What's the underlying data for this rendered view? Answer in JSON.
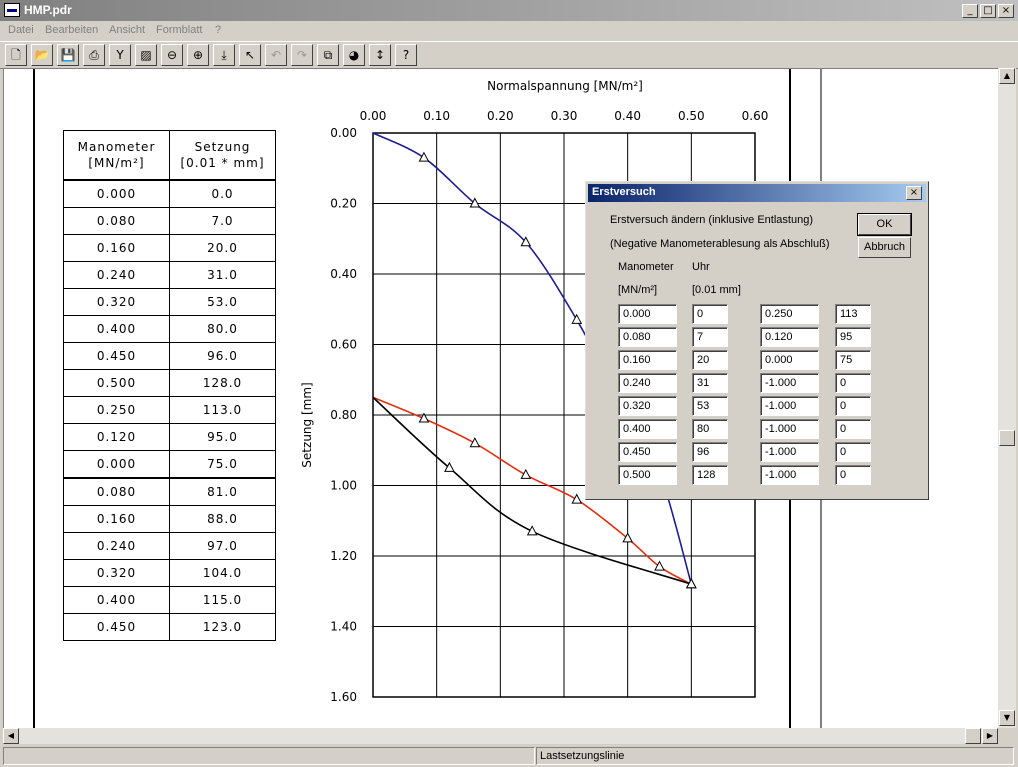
{
  "window": {
    "title": "HMP.pdr"
  },
  "menu": [
    "Datei",
    "Bearbeiten",
    "Ansicht",
    "Formblatt",
    "?"
  ],
  "toolbar_icons": [
    "new-file-icon",
    "open-folder-icon",
    "save-icon",
    "print-icon",
    "tools-icon",
    "print-preview-icon",
    "zoom-out-icon",
    "zoom-in-icon",
    "download-icon",
    "pointer-icon",
    "undo-icon",
    "redo-icon",
    "copy-icon",
    "camera-icon",
    "vertical-arrows-icon",
    "help-icon"
  ],
  "table": {
    "headers": [
      "Manometer\n[MN/m²]",
      "Setzung\n[0.01 * mm]"
    ],
    "rows": [
      [
        "0.000",
        "0.0"
      ],
      [
        "0.080",
        "7.0"
      ],
      [
        "0.160",
        "20.0"
      ],
      [
        "0.240",
        "31.0"
      ],
      [
        "0.320",
        "53.0"
      ],
      [
        "0.400",
        "80.0"
      ],
      [
        "0.450",
        "96.0"
      ],
      [
        "0.500",
        "128.0"
      ],
      [
        "0.250",
        "113.0"
      ],
      [
        "0.120",
        "95.0"
      ],
      [
        "0.000",
        "75.0"
      ],
      [
        "0.080",
        "81.0"
      ],
      [
        "0.160",
        "88.0"
      ],
      [
        "0.240",
        "97.0"
      ],
      [
        "0.320",
        "104.0"
      ],
      [
        "0.400",
        "115.0"
      ],
      [
        "0.450",
        "123.0"
      ]
    ]
  },
  "chart_data": {
    "type": "line",
    "title": "Normalspannung [MN/m²]",
    "xlabel": "Normalspannung [MN/m²]",
    "ylabel": "Setzung [mm]",
    "x_ticks": [
      "0.00",
      "0.10",
      "0.20",
      "0.30",
      "0.40",
      "0.50",
      "0.60"
    ],
    "y_ticks": [
      "0.00",
      "0.20",
      "0.40",
      "0.60",
      "0.80",
      "1.00",
      "1.20",
      "1.40",
      "1.60"
    ],
    "xlim": [
      0,
      0.6
    ],
    "ylim": [
      0,
      1.6
    ],
    "y_inverted": true,
    "x_axis_position": "top",
    "grid": true,
    "series": [
      {
        "color": "#1f1f8f",
        "markers": true,
        "points": [
          [
            0,
            0
          ],
          [
            0.08,
            0.07
          ],
          [
            0.16,
            0.2
          ],
          [
            0.24,
            0.31
          ],
          [
            0.32,
            0.53
          ],
          [
            0.4,
            0.8
          ],
          [
            0.45,
            0.96
          ],
          [
            0.5,
            1.28
          ]
        ]
      },
      {
        "color": "#e03010",
        "markers": true,
        "points": [
          [
            0,
            0.75
          ],
          [
            0.08,
            0.81
          ],
          [
            0.16,
            0.88
          ],
          [
            0.24,
            0.97
          ],
          [
            0.32,
            1.04
          ],
          [
            0.4,
            1.15
          ],
          [
            0.45,
            1.23
          ],
          [
            0.5,
            1.28
          ]
        ]
      },
      {
        "color": "#000000",
        "markers": true,
        "points": [
          [
            0,
            0.75
          ],
          [
            0.12,
            0.95
          ],
          [
            0.25,
            1.13
          ],
          [
            0.5,
            1.28
          ]
        ]
      }
    ]
  },
  "dialog": {
    "title": "Erstversuch",
    "line1": "Erstversuch ändern (inklusive Entlastung)",
    "line2": "(Negative Manometerablesung als Abschluß)",
    "col1_header": "Manometer",
    "col1_unit": "[MN/m²]",
    "col2_header": "Uhr",
    "col2_unit": "[0.01 mm]",
    "ok_label": "OK",
    "cancel_label": "Abbruch",
    "left_rows": [
      [
        "0.000",
        "0"
      ],
      [
        "0.080",
        "7"
      ],
      [
        "0.160",
        "20"
      ],
      [
        "0.240",
        "31"
      ],
      [
        "0.320",
        "53"
      ],
      [
        "0.400",
        "80"
      ],
      [
        "0.450",
        "96"
      ],
      [
        "0.500",
        "128"
      ]
    ],
    "right_rows": [
      [
        "0.250",
        "113"
      ],
      [
        "0.120",
        "95"
      ],
      [
        "0.000",
        "75"
      ],
      [
        "-1.000",
        "0"
      ],
      [
        "-1.000",
        "0"
      ],
      [
        "-1.000",
        "0"
      ],
      [
        "-1.000",
        "0"
      ],
      [
        "-1.000",
        "0"
      ]
    ]
  },
  "status": {
    "text": "Lastsetzungslinie"
  }
}
